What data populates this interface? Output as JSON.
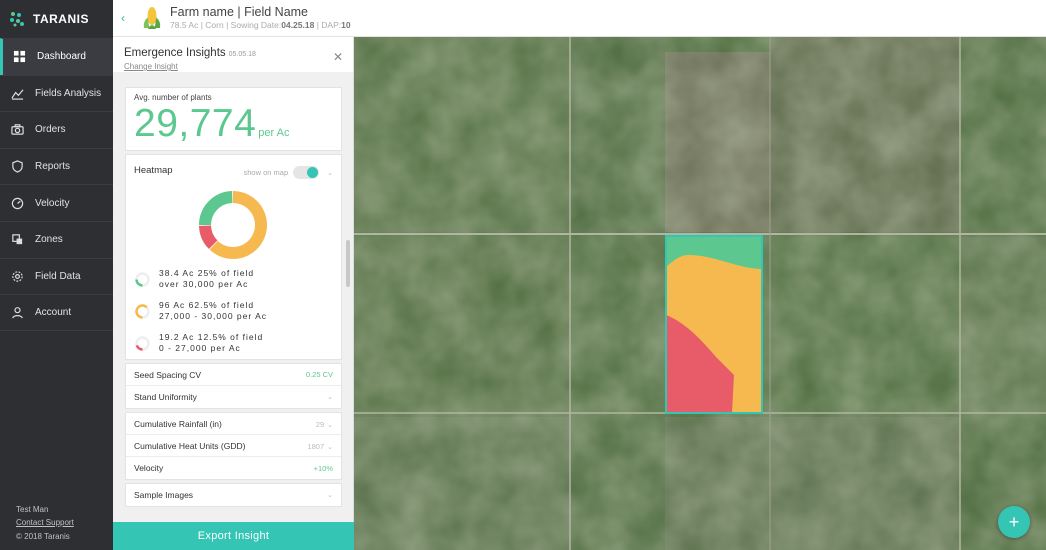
{
  "app": {
    "brand": "TARANIS"
  },
  "sidebar": {
    "items": [
      {
        "label": "Dashboard",
        "icon": "grid-icon",
        "active": true
      },
      {
        "label": "Fields Analysis",
        "icon": "line-chart-icon"
      },
      {
        "label": "Orders",
        "icon": "camera-icon"
      },
      {
        "label": "Reports",
        "icon": "shield-icon"
      },
      {
        "label": "Velocity",
        "icon": "gauge-icon"
      },
      {
        "label": "Zones",
        "icon": "zones-icon"
      },
      {
        "label": "Field Data",
        "icon": "gear-icon"
      },
      {
        "label": "Account",
        "icon": "user-icon"
      }
    ],
    "footer": {
      "user": "Test Man",
      "support": "Contact Support",
      "copyright": "© 2018 Taranis"
    }
  },
  "header": {
    "title": "Farm name | Field Name",
    "acres": "78.5 Ac",
    "crop": "Corn",
    "sowing_label": "Sowing Date:",
    "sowing_date": "04.25.18",
    "dap_label": "DAP:",
    "dap": "10"
  },
  "panel": {
    "title": "Emergence Insights",
    "date": "05.05.18",
    "change": "Change Insight",
    "avg": {
      "label": "Avg. number of plants",
      "value": "29,774",
      "unit": "per Ac"
    },
    "heatmap": {
      "title": "Heatmap",
      "show_on_map": "show on map",
      "toggle_on": true,
      "segments": [
        {
          "line1": "38.4 Ac 25% of field",
          "line2": "over 30,000 per Ac",
          "color": "#5cc88f",
          "fraction": 0.25
        },
        {
          "line1": "96 Ac 62.5% of field",
          "line2": "27,000 - 30,000 per Ac",
          "color": "#f6b94f",
          "fraction": 0.625
        },
        {
          "line1": "19.2 Ac 12.5% of field",
          "line2": "0 - 27,000 per Ac",
          "color": "#e85c6a",
          "fraction": 0.125
        }
      ]
    },
    "rows": [
      {
        "label": "Seed Spacing CV",
        "value": "0.25 CV"
      },
      {
        "label": "Stand Uniformity"
      },
      {
        "label": "Cumulative Rainfall (in)",
        "value": "29"
      },
      {
        "label": "Cumulative Heat Units (GDD)",
        "value": "1807"
      },
      {
        "label": "Velocity",
        "value": "+10%"
      },
      {
        "label": "Sample Images"
      }
    ],
    "export": "Export Insight"
  },
  "colors": {
    "accent": "#35c5b5",
    "green": "#5cc88f",
    "yellow": "#f6b94f",
    "red": "#e85c6a",
    "sidebar": "#2d2f33"
  }
}
